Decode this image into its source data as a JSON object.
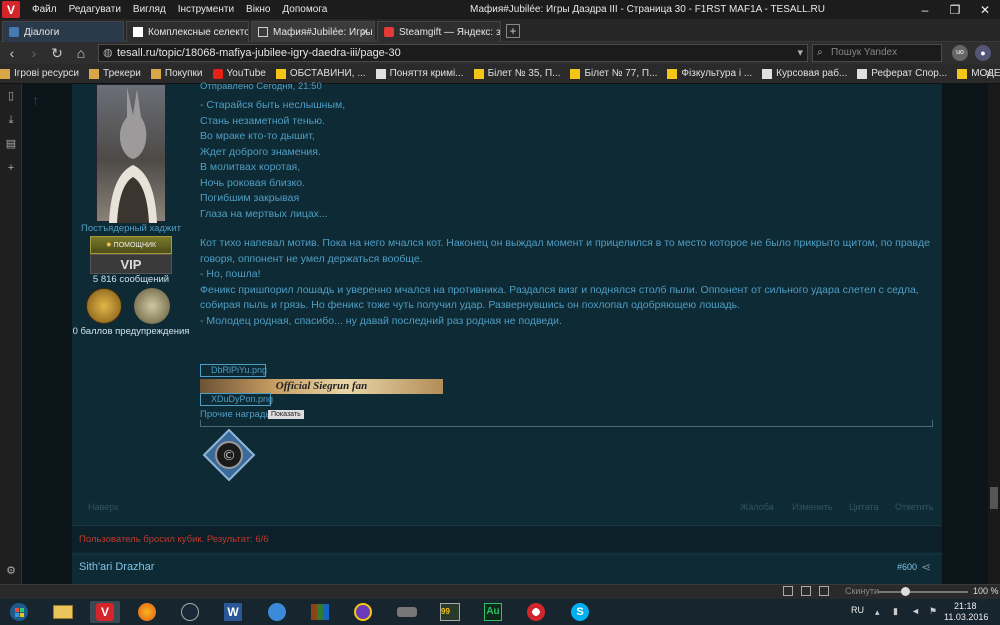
{
  "window": {
    "title": "Мафия#Jubilée: Игры Даэдра III - Страница 30 - F1RST MAF1A - TESALL.RU",
    "menu": [
      "Файл",
      "Редагувати",
      "Вигляд",
      "Інструменти",
      "Вікно",
      "Допомога"
    ]
  },
  "tabs": [
    {
      "label": "Діалоги"
    },
    {
      "label": "Комплексные селекторы |"
    },
    {
      "label": "Мафия#Jubilée: Игры Даэд"
    },
    {
      "label": "Steamgift — Яндекс: знайд"
    }
  ],
  "address": {
    "url": "tesall.ru/topic/18068-mafiya-jubilee-igry-daedra-iii/page-30",
    "search_placeholder": "Пошук Yandex"
  },
  "bookmarks": [
    "Ігрові ресурси",
    "Трекери",
    "Покупки",
    "YouTube",
    "ОБСТАВИНИ, ...",
    "Поняття кримі...",
    "Білет № 35, П...",
    "Білет № 77, П...",
    "Фізкультура і ...",
    "Курсовая раб...",
    "Реферат Спор...",
    "МОДЕЛІ «ІНВ..."
  ],
  "post": {
    "header": "Отправлено Сегодня, 21:50",
    "poem": [
      "- Старайся быть неслышным,",
      "Стань незаметной тенью.",
      "Во мраке кто-то дышит,",
      "Ждет доброго знамения.",
      "В молитвах коротая,",
      "Ночь роковая близко.",
      "Погибшим закрывая",
      "Глаза на мертвых лицах..."
    ],
    "story": [
      "Кот тихо напевал мотив. Пока на него мчался кот. Наконец он выждал момент и прицелился в то место которое не было прикрыто щитом, по правде говоря, оппонент не умел держаться вообще.",
      "- Но, пошла!",
      "Феникс пришпорил лошадь и уверенно мчался на противника. Раздался визг и поднялся столб пыли. Оппонент от сильного удара слетел с седла, собирая пыль и грязь. Но феникс тоже чуть получил удар. Развернувшись он похлопал одобряющею лошадь.",
      "- Молодец родная, спасибо... ну давай последний раз родная не подведи."
    ],
    "images": [
      "DbRlPiYu.png",
      "Official Siegrun fan",
      "XDuDyPon.png"
    ],
    "other_awards": "Прочие награды",
    "show_label": "Показать",
    "actions": [
      "Наверх",
      "Жалоба",
      "Изменить",
      "Цитата",
      "Ответить"
    ],
    "dice_result": "Пользователь бросил кубик. Результат: 6/6"
  },
  "author": {
    "rank": "Постъядерный хаджит",
    "badge": "ПОМОЩНИК",
    "vip": "VIP",
    "messages": "5 816 сообщений",
    "warnings": "0 баллов предупреждения"
  },
  "next_post": {
    "author": "Sith'ari Drazhar",
    "number": "#600"
  },
  "statusbar": {
    "zoom_label": "Скинути",
    "zoom": "100 %"
  },
  "taskbar": {
    "lang": "RU",
    "time": "21:18",
    "date": "11.03.2016"
  },
  "colors": {
    "accent": "#d3262b",
    "link": "#4f9ec4",
    "content_bg": "#0e2a35"
  }
}
